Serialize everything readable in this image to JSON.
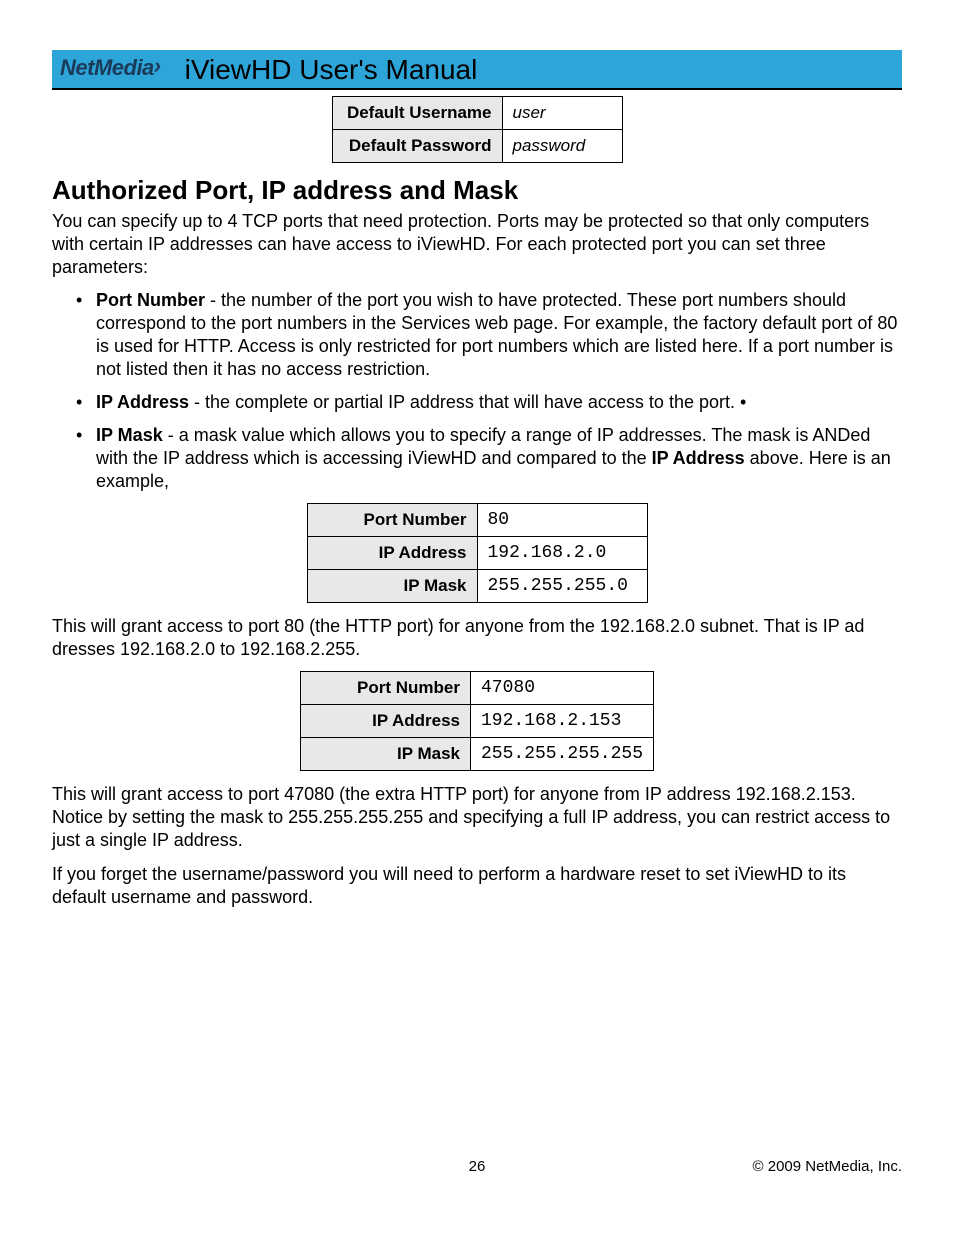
{
  "header": {
    "logo_text": "NetMedia",
    "title": "iViewHD User's Manual"
  },
  "credentials_table": {
    "rows": [
      {
        "label": "Default Username",
        "value": "user"
      },
      {
        "label": "Default Password",
        "value": "password"
      }
    ]
  },
  "section_heading": "Authorized Port, IP address and Mask",
  "intro_paragraph": "You can specify up to 4 TCP ports that need protection. Ports may be protected so that only computers with certain IP addresses can have access to iViewHD. For each protected port you can set three parameters:",
  "bullets": [
    {
      "term": "Port Number",
      "text": " - the number of the port you wish to have protected. These port numbers should correspond to the port numbers in the Services web page. For example, the factory default port of 80 is used for HTTP. Access is only restricted for port numbers which are listed here. If a port number is not listed then it has no access restriction."
    },
    {
      "term": "IP Address",
      "text": " - the complete or partial IP address that will have access to the port. •"
    },
    {
      "term": "IP Mask",
      "text_pre": " - a mask value which allows you to specify a range of IP addresses. The mask is ANDed with the IP address which is accessing iViewHD and compared to the ",
      "bold_mid": "IP Address",
      "text_post": " above. Here is an example,"
    }
  ],
  "example1_table": {
    "rows": [
      {
        "label": "Port Number",
        "value": "80"
      },
      {
        "label": "IP Address",
        "value": "192.168.2.0"
      },
      {
        "label": "IP Mask",
        "value": "255.255.255.0"
      }
    ]
  },
  "para_after_ex1": "This will grant access to port 80 (the HTTP port) for anyone from the 192.168.2.0 subnet. That is IP ad dresses 192.168.2.0 to 192.168.2.255.",
  "example2_table": {
    "rows": [
      {
        "label": "Port Number",
        "value": "47080"
      },
      {
        "label": "IP Address",
        "value": "192.168.2.153"
      },
      {
        "label": "IP Mask",
        "value": "255.255.255.255"
      }
    ]
  },
  "para_after_ex2": "This will grant access to port 47080 (the extra HTTP port) for anyone from IP address 192.168.2.153. Notice by setting the mask to 255.255.255.255 and specifying a full IP address, you can restrict access to just a single IP address.",
  "para_reset": "If you forget the username/password you will need to perform a hardware reset to set iViewHD to its default username and password.",
  "footer": {
    "page_number": "26",
    "copyright": "© 2009 NetMedia, Inc."
  }
}
